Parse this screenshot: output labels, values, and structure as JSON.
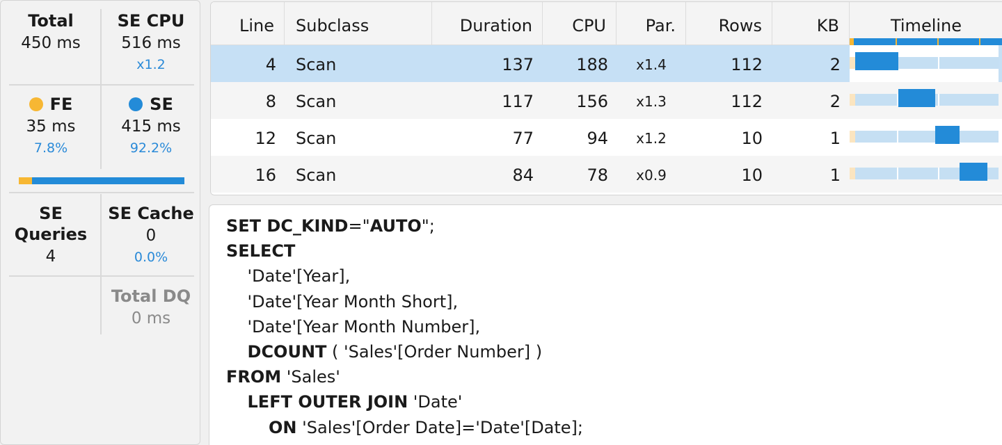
{
  "metrics": {
    "total": {
      "label": "Total",
      "value": "450 ms"
    },
    "se_cpu": {
      "label": "SE CPU",
      "value": "516 ms",
      "ratio": "x1.2"
    },
    "fe": {
      "label": "FE",
      "value": "35 ms",
      "pct": "7.8%"
    },
    "se": {
      "label": "SE",
      "value": "415 ms",
      "pct": "92.2%"
    },
    "se_queries": {
      "label": "SE Queries",
      "value": "4"
    },
    "se_cache": {
      "label": "SE Cache",
      "value": "0",
      "pct": "0.0%"
    },
    "total_dq": {
      "label": "Total DQ",
      "value": "0 ms"
    },
    "fe_se_ratio": {
      "fe_fraction": 0.078,
      "se_fraction": 0.922
    },
    "colors": {
      "fe": "#f7b733",
      "se": "#238bd8",
      "pct_text": "#2a8ad8"
    }
  },
  "table": {
    "columns": [
      "Line",
      "Subclass",
      "Duration",
      "CPU",
      "Par.",
      "Rows",
      "KB",
      "Timeline"
    ],
    "rows": [
      {
        "line": "4",
        "subclass": "Scan",
        "duration": "137",
        "cpu": "188",
        "par": "x1.4",
        "rows": "112",
        "kb": "2",
        "timeline_start": 0.0,
        "timeline_end": 0.3,
        "selected": true
      },
      {
        "line": "8",
        "subclass": "Scan",
        "duration": "117",
        "cpu": "156",
        "par": "x1.3",
        "rows": "112",
        "kb": "2",
        "timeline_start": 0.3,
        "timeline_end": 0.56
      },
      {
        "line": "12",
        "subclass": "Scan",
        "duration": "77",
        "cpu": "94",
        "par": "x1.2",
        "rows": "10",
        "kb": "1",
        "timeline_start": 0.56,
        "timeline_end": 0.73
      },
      {
        "line": "16",
        "subclass": "Scan",
        "duration": "84",
        "cpu": "78",
        "par": "x0.9",
        "rows": "10",
        "kb": "1",
        "timeline_start": 0.73,
        "timeline_end": 0.92
      }
    ],
    "colors": {
      "selected_row": "#c6e0f5",
      "alt_row": "#f5f5f5",
      "timeline_track": "#c5dff3",
      "timeline_bar": "#238bd8"
    }
  },
  "query": {
    "lines": [
      [
        {
          "t": "SET DC_KIND",
          "b": true
        },
        {
          "t": "=\"",
          "b": false
        },
        {
          "t": "AUTO",
          "b": true
        },
        {
          "t": "\";",
          "b": false
        }
      ],
      [
        {
          "t": "SELECT",
          "b": true
        }
      ],
      [
        {
          "t": "    'Date'[Year],",
          "b": false
        }
      ],
      [
        {
          "t": "    'Date'[Year Month Short],",
          "b": false
        }
      ],
      [
        {
          "t": "    'Date'[Year Month Number],",
          "b": false
        }
      ],
      [
        {
          "t": "    ",
          "b": false
        },
        {
          "t": "DCOUNT",
          "b": true
        },
        {
          "t": " ( 'Sales'[Order Number] )",
          "b": false
        }
      ],
      [
        {
          "t": "FROM",
          "b": true
        },
        {
          "t": " 'Sales'",
          "b": false
        }
      ],
      [
        {
          "t": "    ",
          "b": false
        },
        {
          "t": "LEFT OUTER JOIN",
          "b": true
        },
        {
          "t": " 'Date'",
          "b": false
        }
      ],
      [
        {
          "t": "        ",
          "b": false
        },
        {
          "t": "ON",
          "b": true
        },
        {
          "t": " 'Sales'[Order Date]='Date'[Date];",
          "b": false
        }
      ]
    ]
  }
}
